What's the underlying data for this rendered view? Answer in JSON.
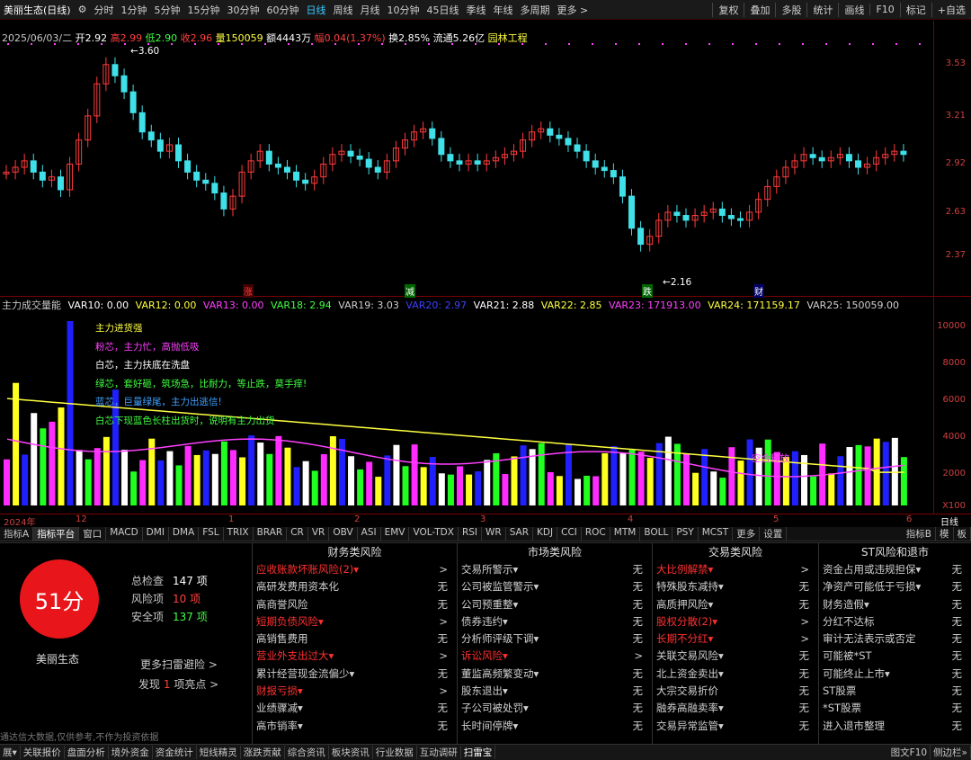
{
  "topbar": {
    "title": "美丽生态(日线)",
    "periods": [
      "分时",
      "1分钟",
      "5分钟",
      "15分钟",
      "30分钟",
      "60分钟",
      "日线",
      "周线",
      "月线",
      "10分钟",
      "45日线",
      "季线",
      "年线",
      "多周期",
      "更多 >"
    ],
    "right": [
      "复权",
      "叠加",
      "多股",
      "统计",
      "画线",
      "F10",
      "标记",
      "+自选"
    ]
  },
  "quote": {
    "date": "2025/06/03/二",
    "open": "开2.92",
    "high": "高2.99",
    "low": "低2.90",
    "close": "收2.96",
    "vol": "量150059",
    "amt": "额4443万",
    "chg": "幅0.04(1.37%)",
    "turn": "换2.85%",
    "flow": "流通5.26亿",
    "sector": "园林工程"
  },
  "price_axis": [
    "3.53",
    "3.21",
    "2.92",
    "2.63",
    "2.37"
  ],
  "marks": {
    "high": "3.60",
    "low": "2.16"
  },
  "tags": [
    "涨",
    "减",
    "跌",
    "财"
  ],
  "indicator": {
    "name": "主力成交量能",
    "vars": [
      {
        "t": "VAR10: 0.00",
        "c": "#ffffff"
      },
      {
        "t": "VAR12: 0.00",
        "c": "#ffff40"
      },
      {
        "t": "VAR13: 0.00",
        "c": "#ff40ff"
      },
      {
        "t": "VAR18: 2.94",
        "c": "#40ff40"
      },
      {
        "t": "VAR19: 3.03",
        "c": "#d0d0d0"
      },
      {
        "t": "VAR20: 2.97",
        "c": "#4040ff"
      },
      {
        "t": "VAR21: 2.88",
        "c": "#ffffff"
      },
      {
        "t": "VAR22: 2.85",
        "c": "#ffff40"
      },
      {
        "t": "VAR23: 171913.00",
        "c": "#ff40ff"
      },
      {
        "t": "VAR24: 171159.17",
        "c": "#ffff40"
      },
      {
        "t": "VAR25: 150059.00",
        "c": "#d0d0d0"
      }
    ]
  },
  "vol_axis": [
    "10000",
    "8000",
    "6000",
    "4000",
    "2000",
    "X100"
  ],
  "legend": [
    {
      "t": "主力进货强",
      "c": "#ffff40"
    },
    {
      "t": "粉芯，主力忙，高抛低吸",
      "c": "#ff40ff"
    },
    {
      "t": "白芯，主力扶底在洗盘",
      "c": "#ffffff"
    },
    {
      "t": "绿芯，套好砸，筑场急，比耐力，等止跌，莫手痒!",
      "c": "#40ff40"
    },
    {
      "t": "蓝芯，巨量绿尾，主力出逃信!",
      "c": "#40a0ff"
    },
    {
      "t": "白芯下现蓝色长柱出货时，说明有主力出货",
      "c": "#40ff40"
    }
  ],
  "vol_notes": [
    "空合释放"
  ],
  "dates": [
    "2024年",
    "12",
    "1",
    "2",
    "3",
    "4",
    "5",
    "6",
    "日线"
  ],
  "tabs": [
    "指标A",
    "指标平台",
    "窗口",
    "MACD",
    "DMI",
    "DMA",
    "FSL",
    "TRIX",
    "BRAR",
    "CR",
    "VR",
    "OBV",
    "ASI",
    "EMV",
    "VOL-TDX",
    "RSI",
    "WR",
    "SAR",
    "KDJ",
    "CCI",
    "ROC",
    "MTM",
    "BOLL",
    "PSY",
    "MCST",
    "更多",
    "设置"
  ],
  "tabs_right": [
    "指标B",
    "模",
    "板"
  ],
  "scan": {
    "score": "51分",
    "stock": "美丽生态",
    "total_label": "总检查",
    "total": "147 项",
    "risk_label": "风险项",
    "risk": "10 项",
    "safe_label": "安全项",
    "safe": "137 项",
    "more": "更多扫雷避险 >",
    "found_a": "发现",
    "found_n": "1",
    "found_b": "项亮点 >",
    "disclaimer": "通达信大数据,仅供参考,不作为投资依据"
  },
  "columns": [
    {
      "title": "财务类风险",
      "items": [
        {
          "l": "应收账款坏账风险(2)▾",
          "v": ">",
          "r": 1
        },
        {
          "l": "高研发费用资本化",
          "v": "无"
        },
        {
          "l": "高商誉风险",
          "v": "无"
        },
        {
          "l": "短期负债风险▾",
          "v": ">",
          "r": 1
        },
        {
          "l": "高销售费用",
          "v": "无"
        },
        {
          "l": "营业外支出过大▾",
          "v": ">",
          "r": 1
        },
        {
          "l": "累计经营现金流偏少▾",
          "v": "无"
        },
        {
          "l": "财报亏损▾",
          "v": ">",
          "r": 1
        },
        {
          "l": "业绩骤减▾",
          "v": "无"
        },
        {
          "l": "高市销率▾",
          "v": "无"
        }
      ]
    },
    {
      "title": "市场类风险",
      "items": [
        {
          "l": "交易所警示▾",
          "v": "无"
        },
        {
          "l": "公司被监管警示▾",
          "v": "无"
        },
        {
          "l": "公司预重整▾",
          "v": "无"
        },
        {
          "l": "债券违约▾",
          "v": "无"
        },
        {
          "l": "分析师评级下调▾",
          "v": "无"
        },
        {
          "l": "诉讼风险▾",
          "v": ">",
          "r": 1
        },
        {
          "l": "董监高频繁变动▾",
          "v": "无"
        },
        {
          "l": "股东退出▾",
          "v": "无"
        },
        {
          "l": "子公司被处罚▾",
          "v": "无"
        },
        {
          "l": "长时间停牌▾",
          "v": "无"
        }
      ]
    },
    {
      "title": "交易类风险",
      "items": [
        {
          "l": "大比例解禁▾",
          "v": ">",
          "r": 1
        },
        {
          "l": "特殊股东减持▾",
          "v": "无"
        },
        {
          "l": "高质押风险▾",
          "v": "无"
        },
        {
          "l": "股权分散(2)▾",
          "v": ">",
          "r": 1
        },
        {
          "l": "长期不分红▾",
          "v": ">",
          "r": 1
        },
        {
          "l": "关联交易风险▾",
          "v": "无"
        },
        {
          "l": "北上资金卖出▾",
          "v": "无"
        },
        {
          "l": "大宗交易折价",
          "v": "无"
        },
        {
          "l": "融券高融卖率▾",
          "v": "无"
        },
        {
          "l": "交易异常监管▾",
          "v": "无"
        }
      ]
    },
    {
      "title": "ST风险和退市",
      "items": [
        {
          "l": "资金占用或违规担保▾",
          "v": "无"
        },
        {
          "l": "净资产可能低于亏损▾",
          "v": "无"
        },
        {
          "l": "财务造假▾",
          "v": "无"
        },
        {
          "l": "分红不达标",
          "v": "无"
        },
        {
          "l": "审计无法表示或否定",
          "v": "无"
        },
        {
          "l": "可能被*ST",
          "v": "无"
        },
        {
          "l": "可能终止上市▾",
          "v": "无"
        },
        {
          "l": "ST股票",
          "v": "无"
        },
        {
          "l": "*ST股票",
          "v": "无"
        },
        {
          "l": "进入退市整理",
          "v": "无"
        }
      ]
    }
  ],
  "status": [
    "展▾",
    "关联报价",
    "盘面分析",
    "境外资金",
    "资金统计",
    "短线精灵",
    "涨跌贡献",
    "综合资讯",
    "板块资讯",
    "行业数据",
    "互动调研",
    "扫雷宝"
  ],
  "status_right": [
    "图文F10",
    "侧边栏»"
  ]
}
